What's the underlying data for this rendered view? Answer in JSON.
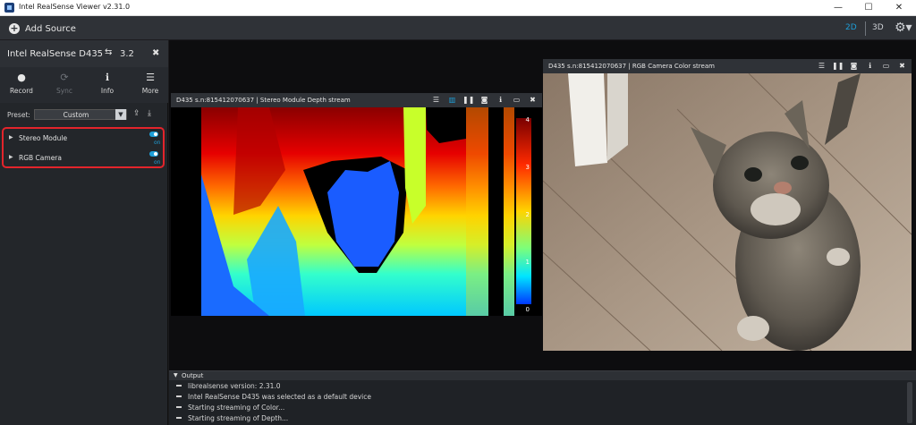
{
  "window": {
    "title": "Intel RealSense Viewer v2.31.0",
    "controls": {
      "minimize": "—",
      "maximize": "☐",
      "close": "✕"
    }
  },
  "topbar": {
    "add_source": "Add Source",
    "view_2d": "2D",
    "view_3d": "3D",
    "active_view": "2D",
    "gear_icon": "⚙▾"
  },
  "device": {
    "name": "Intel RealSense D435",
    "usb_icon": "⇆",
    "usb_version": "3.2",
    "close": "✖",
    "toolbar": [
      {
        "icon": "●",
        "label": "Record"
      },
      {
        "icon": "⟳",
        "label": "Sync"
      },
      {
        "icon": "ℹ",
        "label": "Info"
      },
      {
        "icon": "☰",
        "label": "More"
      }
    ],
    "preset_label": "Preset:",
    "preset_value": "Custom",
    "modules": [
      {
        "label": "Stereo Module",
        "state": "on"
      },
      {
        "label": "RGB Camera",
        "state": "on"
      }
    ]
  },
  "depth_stream": {
    "title": "D435 s.n:815412070637 | Stereo Module Depth stream",
    "colorbar_ticks": [
      "4",
      "3",
      "2",
      "1",
      "0"
    ]
  },
  "color_stream": {
    "title": "D435 s.n:815412070637 | RGB Camera Color stream"
  },
  "output": {
    "title": "Output",
    "lines": [
      "librealsense version: 2.31.0",
      "Intel RealSense D435 was selected as a default device",
      "Starting streaming of Color...",
      "Starting streaming of Depth..."
    ]
  },
  "colors": {
    "accent": "#1e9fd8",
    "highlight": "#e3242b",
    "panel": "#23262a"
  }
}
